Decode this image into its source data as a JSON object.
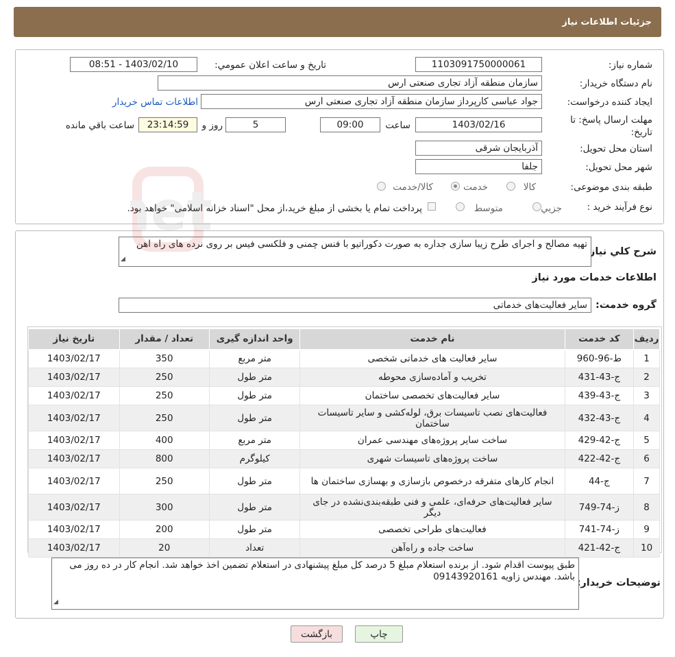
{
  "header": {
    "title": "جزئیات اطلاعات نیاز"
  },
  "need": {
    "number_label": "شماره نیاز:",
    "number_value": "1103091750000061",
    "announce_label": "تاریخ و ساعت اعلان عمومي:",
    "announce_value": "1403/02/10 - 08:51",
    "buyer_label": "نام دستگاه خريدار:",
    "buyer_value": "سازمان منطقه آزاد تجاری صنعتی ارس",
    "creator_label": "ايجاد کننده درخواست:",
    "creator_value": "جواد عباسی کارپرداز سازمان منطقه آزاد تجاری صنعتی ارس",
    "contact_link": "اطلاعات تماس خريدار",
    "deadline_label_1": "مهلت ارسال پاسخ: تا",
    "deadline_label_2": "تاريخ:",
    "deadline_date": "1403/02/16",
    "time_label": "ساعت",
    "deadline_time": "09:00",
    "days_value": "5",
    "days_label": "روز و",
    "remaining_value": "23:14:59",
    "remaining_label": "ساعت باقي مانده",
    "province_label": "استان محل تحويل:",
    "province_value": "آذربايجان شرقی",
    "city_label": "شهر محل تحويل:",
    "city_value": "جلفا",
    "category_label": "طبقه بندی موضوعی:",
    "category_options": [
      "کالا",
      "خدمت",
      "کالا/خدمت"
    ],
    "category_selected": "خدمت",
    "process_label": "نوع فرآيند خريد :",
    "process_options": [
      "جزیي",
      "متوسط"
    ],
    "process_note": "پرداخت تمام یا بخشی از مبلغ خرید،از محل \"اسناد خزانه اسلامی\" خواهد بود."
  },
  "summary": {
    "label": "شرح کلي نياز:",
    "text": "تهیه مصالح و اجرای طرح زیبا سازی جداره به صورت دکوراتیو با فنس چمنی و فلکسی فیس بر روی نرده های راه اهن",
    "services_title": "اطلاعات خدمات مورد نياز",
    "group_label": "گروه خدمت:",
    "group_value": "ساير فعاليت‌های خدماتی"
  },
  "table": {
    "headers": [
      "رديف",
      "کد خدمت",
      "نام خدمت",
      "واحد اندازه گيری",
      "تعداد / مقدار",
      "تاريخ نياز"
    ],
    "rows": [
      [
        "1",
        "ط-96-960",
        "سایر فعالیت های خدماتی شخصی",
        "متر مربع",
        "350",
        "1403/02/17"
      ],
      [
        "2",
        "ج-43-431",
        "تخریب و آماده‌سازی محوطه",
        "متر طول",
        "250",
        "1403/02/17"
      ],
      [
        "3",
        "ج-43-439",
        "سایر فعالیت‌های تخصصی ساختمان",
        "متر طول",
        "250",
        "1403/02/17"
      ],
      [
        "4",
        "ج-43-432",
        "فعالیت‌های نصب تاسیسات برق، لوله‌کشی و سایر تاسیسات ساختمان",
        "متر طول",
        "250",
        "1403/02/17"
      ],
      [
        "5",
        "ج-42-429",
        "ساخت سایر پروژه‌های مهندسی عمران",
        "متر مربع",
        "400",
        "1403/02/17"
      ],
      [
        "6",
        "ج-42-422",
        "ساخت پروژه‌های تاسیسات شهری",
        "کیلوگرم",
        "800",
        "1403/02/17"
      ],
      [
        "7",
        "ج-44",
        "انجام کارهای متفرقه درخصوص بازسازی و بهسازی ساختمان ها",
        "متر طول",
        "250",
        "1403/02/17"
      ],
      [
        "8",
        "ز-74-749",
        "سایر فعالیت‌های حرفه‌ای، علمی و فنی طبقه‌بندی‌نشده در جای دیگر",
        "متر طول",
        "300",
        "1403/02/17"
      ],
      [
        "9",
        "ز-74-741",
        "فعالیت‌های طراحی تخصصی",
        "متر طول",
        "200",
        "1403/02/17"
      ],
      [
        "10",
        "ج-42-421",
        "ساخت جاده و راه‌آهن",
        "تعداد",
        "20",
        "1403/02/17"
      ]
    ]
  },
  "notes": {
    "label": "توضيحات خريدار:",
    "text": "طبق پیوست اقدام شود. از برنده استعلام مبلغ 5 درصد کل مبلغ پیشنهادی در استعلام تضمین اخذ خواهد شد. انجام کار در ده روز می باشد. مهندس  زاویه 09143920161"
  },
  "buttons": {
    "back": "بازگشت",
    "print": "چاپ"
  },
  "watermark": {
    "text": "AriaTender.net"
  },
  "colors": {
    "header_bg": "#8b6e4e",
    "link": "#1a5bbf",
    "back_btn": "#f7dede",
    "print_btn": "#e6f5e0"
  }
}
